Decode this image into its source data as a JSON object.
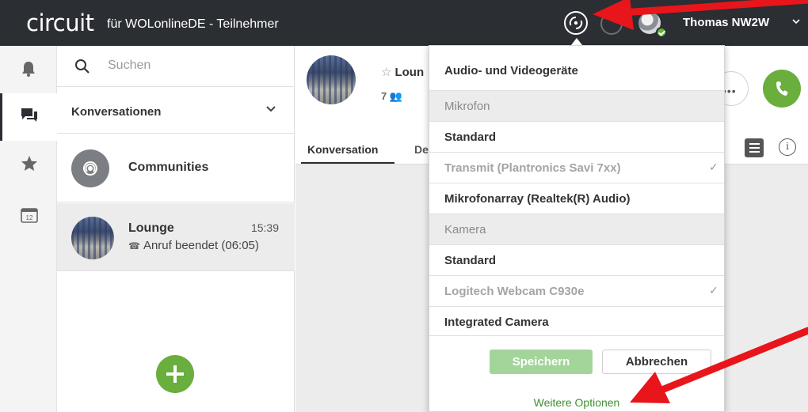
{
  "app": {
    "logo": "circuit",
    "subtitle": "für WOLonlineDE - Teilnehmer",
    "accent_color": "#6aae3d"
  },
  "topbar": {
    "device_button_icon": "audio-video-settings-icon",
    "user_name": "Thomas NW2W",
    "user_chevron": "⌄",
    "presence": "available"
  },
  "rail": {
    "items": [
      {
        "name": "notifications",
        "icon": "bell-icon"
      },
      {
        "name": "conversations",
        "icon": "chat-icon",
        "active": true
      },
      {
        "name": "favorites",
        "icon": "star-icon"
      },
      {
        "name": "calendar",
        "icon": "calendar-icon",
        "badge": "12"
      }
    ]
  },
  "list": {
    "search_placeholder": "Suchen",
    "filter_label": "Konversationen",
    "conversations": [
      {
        "title": "Communities",
        "icon": "communities-icon"
      },
      {
        "title": "Lounge",
        "time": "15:39",
        "subtitle": "Anruf beendet (06:05)"
      }
    ]
  },
  "conversation": {
    "title": "Loun",
    "participants": "7",
    "tabs": [
      "Konversation",
      "De"
    ]
  },
  "device_menu": {
    "header": "Audio- und Videogeräte",
    "rows": [
      {
        "type": "section",
        "label": "Mikrofon"
      },
      {
        "type": "option",
        "label": "Standard"
      },
      {
        "type": "selected",
        "label": "Transmit (Plantronics Savi 7xx)",
        "check": "✓"
      },
      {
        "type": "option",
        "label": "Mikrofonarray (Realtek(R) Audio)"
      },
      {
        "type": "section",
        "label": "Kamera"
      },
      {
        "type": "option",
        "label": "Standard"
      },
      {
        "type": "selected",
        "label": "Logitech Webcam C930e",
        "check": "✓"
      },
      {
        "type": "option",
        "label": "Integrated Camera"
      }
    ],
    "save_label": "Speichern",
    "cancel_label": "Abbrechen",
    "more_options_label": "Weitere Optionen"
  },
  "annotations": {
    "arrow_color": "#e8151b"
  }
}
